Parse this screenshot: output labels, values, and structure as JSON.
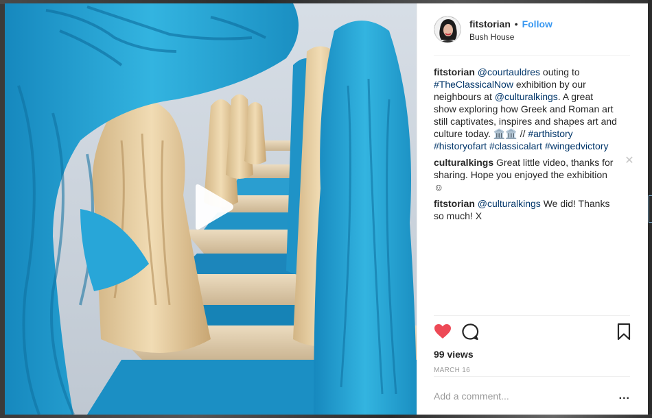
{
  "post": {
    "username": "fitstorian",
    "separator": "•",
    "follow_label": "Follow",
    "location": "Bush House"
  },
  "caption": {
    "user": "fitstorian",
    "parts": [
      {
        "type": "mention",
        "text": "@courtauldres"
      },
      {
        "type": "text",
        "text": " outing to "
      },
      {
        "type": "hashtag",
        "text": "#TheClassicalNow"
      },
      {
        "type": "text",
        "text": " exhibition by our neighbours at "
      },
      {
        "type": "mention",
        "text": "@culturalkings"
      },
      {
        "type": "text",
        "text": ". A great show exploring how Greek and Roman art still captivates, inspires and shapes art and culture today. "
      },
      {
        "type": "text",
        "text": "🏛️🏛️ // "
      },
      {
        "type": "hashtag",
        "text": "#arthistory"
      },
      {
        "type": "text",
        "text": " "
      },
      {
        "type": "hashtag",
        "text": "#historyofart"
      },
      {
        "type": "text",
        "text": " "
      },
      {
        "type": "hashtag",
        "text": "#classicalart"
      },
      {
        "type": "text",
        "text": " "
      },
      {
        "type": "hashtag",
        "text": "#wingedvictory"
      }
    ]
  },
  "comments": [
    {
      "user": "culturalkings",
      "parts": [
        {
          "type": "text",
          "text": " Great little video, thanks for sharing. Hope you enjoyed the exhibition ☺"
        }
      ]
    },
    {
      "user": "fitstorian",
      "parts": [
        {
          "type": "text",
          "text": " "
        },
        {
          "type": "mention",
          "text": "@culturalkings"
        },
        {
          "type": "text",
          "text": " We did! Thanks so much! X"
        }
      ]
    }
  ],
  "stats": {
    "views": "99 views",
    "date": "MARCH 16"
  },
  "add_comment": {
    "placeholder": "Add a comment...",
    "more_options": "..."
  },
  "icons": {
    "like": "heart-icon",
    "comment": "comment-bubble-icon",
    "save": "bookmark-icon",
    "play": "play-icon",
    "close": "close-icon"
  },
  "colors": {
    "like_red": "#ed4956",
    "link_blue": "#003569",
    "follow_blue": "#3897f0",
    "statue_blue": "#2aa3d1",
    "statue_cream": "#e8cfa4"
  }
}
